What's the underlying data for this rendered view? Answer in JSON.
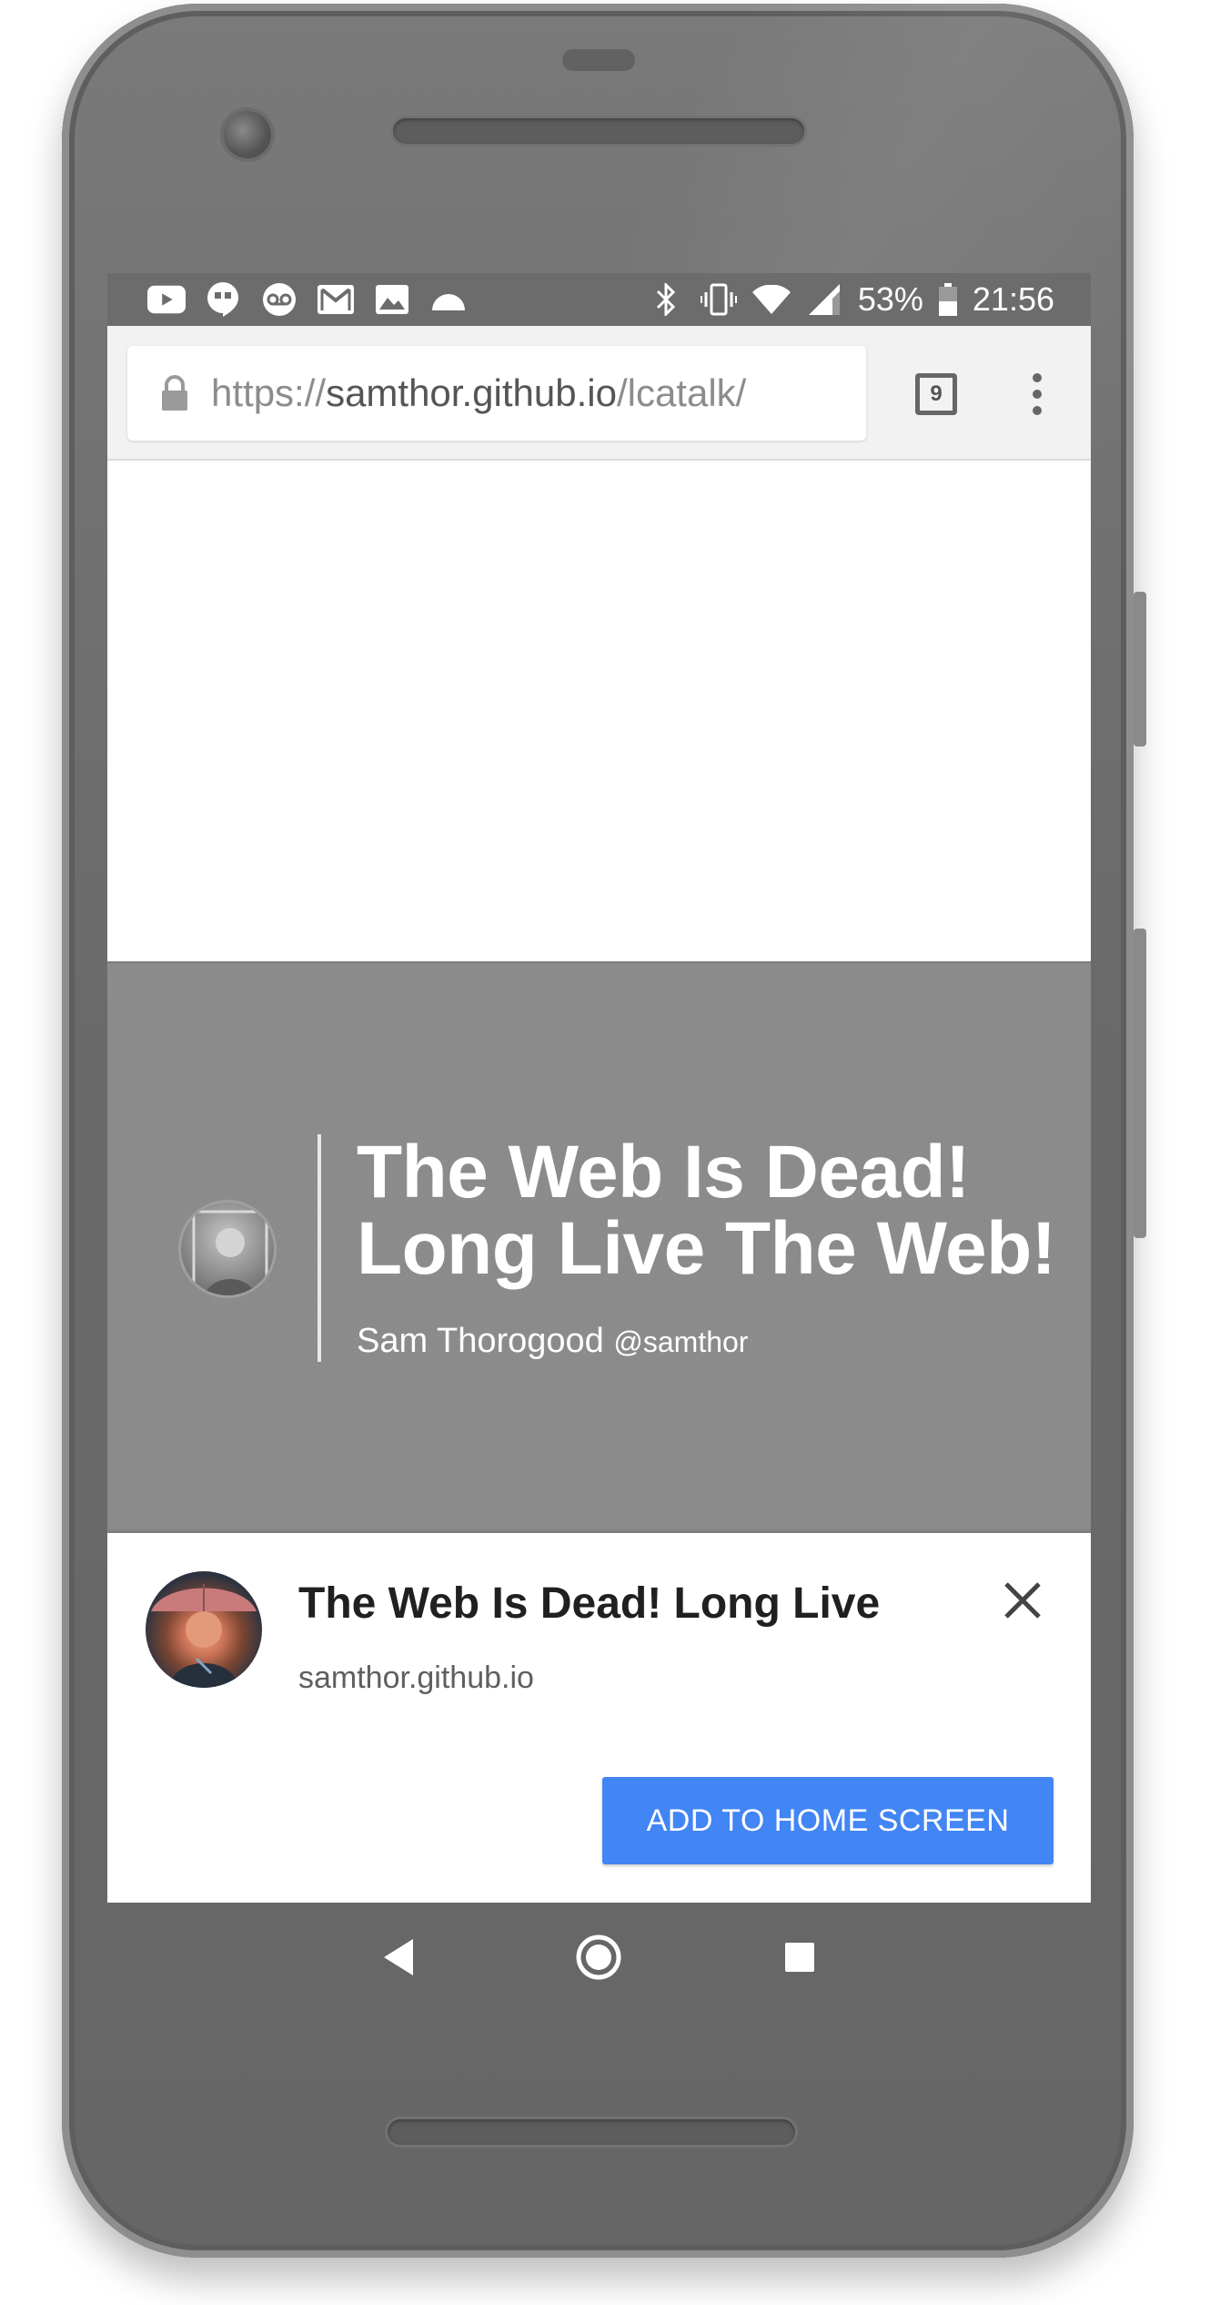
{
  "status_bar": {
    "left_icons": [
      "youtube-icon",
      "hangouts-icon",
      "voicemail-icon",
      "gmail-icon",
      "photos-icon",
      "android-icon"
    ],
    "right_icons": [
      "bluetooth-icon",
      "vibrate-icon",
      "wifi-icon",
      "signal-icon"
    ],
    "battery_percent": "53%",
    "time": "21:56"
  },
  "browser": {
    "url_scheme": "https://",
    "url_host": "samthor.github.io",
    "url_path": "/lcatalk/",
    "tab_count": "9"
  },
  "hero": {
    "title_line1": "The Web Is Dead!",
    "title_line2": "Long Live The Web!",
    "author": "Sam Thorogood",
    "handle": "@samthor"
  },
  "install_banner": {
    "title": "The Web Is Dead! Long Live",
    "host": "samthor.github.io",
    "button_label": "ADD TO HOME SCREEN",
    "button_color": "#4285f4"
  },
  "nav": {
    "buttons": [
      "back-icon",
      "home-icon",
      "recents-icon"
    ]
  }
}
